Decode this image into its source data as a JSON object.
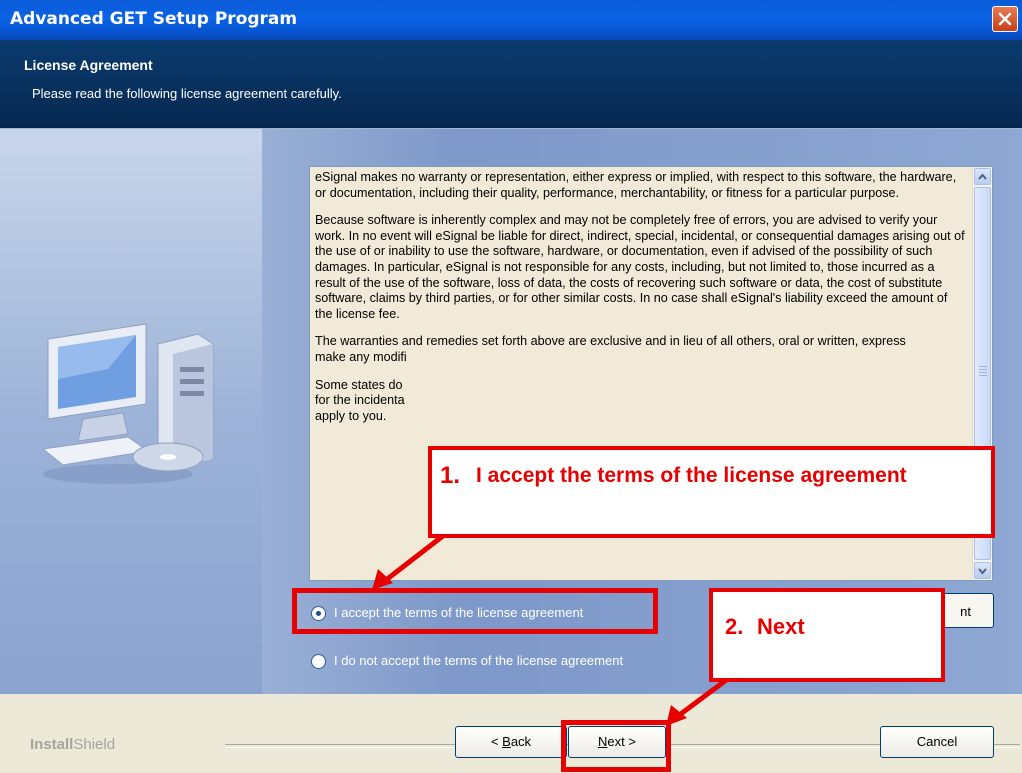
{
  "window": {
    "title": "Advanced GET Setup Program"
  },
  "header": {
    "title": "License Agreement",
    "subtitle": "Please read the following license agreement carefully."
  },
  "license": {
    "paragraphs": [
      "eSignal makes no warranty or representation, either express or implied, with respect to this software, the hardware, or documentation, including their quality, performance, merchantability, or fitness for a particular purpose.",
      "Because software is inherently complex and may not be completely free of errors, you are advised to verify your work.  In no event will eSignal be liable for direct, indirect, special, incidental, or consequential damages arising out of the use of or inability to use the software, hardware, or documentation, even if advised of the possibility of such damages.  In particular, eSignal is not responsible for any costs, including, but not limited to, those incurred as a result of the use of the software, loss of data, the costs of recovering such software or data, the cost of substitute software, claims by third parties, or for other similar costs.  In no case shall eSignal's liability exceed the amount of the license fee.",
      "The warranties and remedies set forth above are exclusive and in lieu of all others, oral or written, express",
      "Some states do",
      "for the incidenta",
      "apply to you."
    ],
    "partial_lines": [
      "make any modifi"
    ]
  },
  "options": {
    "accept": "I accept the terms of the license agreement",
    "decline": "I do not accept the terms of the license agreement",
    "selected": "accept"
  },
  "print_button": {
    "label": "nt"
  },
  "footer": {
    "brand_bold": "Install",
    "brand_light": "Shield",
    "back": {
      "prefix": "< ",
      "mnemonic": "B",
      "rest": "ack"
    },
    "next": {
      "mnemonic": "N",
      "rest": "ext >"
    },
    "cancel": "Cancel"
  },
  "annotations": {
    "callout1": {
      "number": "1.",
      "text": "I accept the terms of the license agreement"
    },
    "callout2": {
      "number": "2.",
      "text": "Next"
    }
  },
  "colors": {
    "annotation_red": "#e60000",
    "titlebar_blue": "#0b63e5",
    "header_navy": "#0b3b6f"
  }
}
